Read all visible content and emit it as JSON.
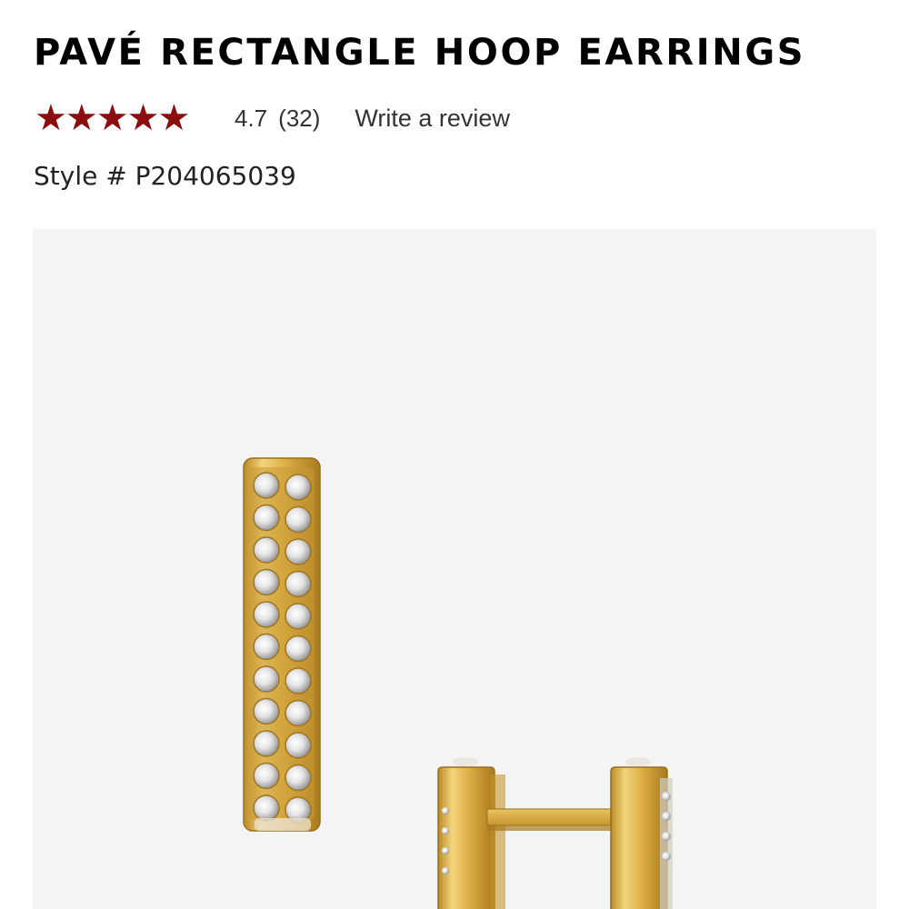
{
  "product": {
    "title": "PAVÉ RECTANGLE HOOP EARRINGS",
    "rating": {
      "value": "4.7",
      "count": "(32)",
      "stars_out_of_5": 4.7,
      "stars_glyphs": "★★★★★",
      "write_review_label": "Write a review"
    },
    "style_label": "Style # P204065039",
    "image": {
      "icon": "product-photo-earrings"
    }
  },
  "colors": {
    "star": "#8b0d0d",
    "panel_background": "#f4f4f4",
    "gold": "#d9ad3f"
  }
}
